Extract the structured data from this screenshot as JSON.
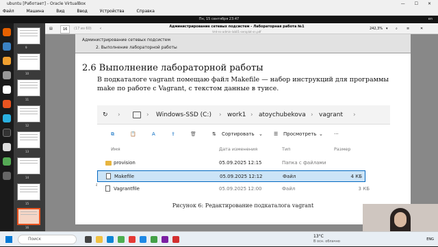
{
  "vbox": {
    "title": "ubuntu [Работает] - Oracle VirtualBox",
    "menu": [
      "Файл",
      "Машина",
      "Вид",
      "Ввод",
      "Устройства",
      "Справка"
    ]
  },
  "gnome": {
    "clock": "Пн, 15 сентября  23:47",
    "lang": "en"
  },
  "viewer": {
    "page_num": "16",
    "page_of": "(17 из 60)",
    "doc_title": "Администрирование сетевых подсистем - Лабораторная работа №1",
    "doc_path": "tmt-ns-admin-lab01-seroplat-sn.pdf",
    "zoom": "242,3%",
    "thumbs": [
      "9",
      "10",
      "11",
      "12",
      "13",
      "14",
      "15",
      "16"
    ]
  },
  "doc": {
    "header_line1": "Администрирование сетевых подсистем",
    "header_line2": "2. Выполнение лабораторной работы",
    "section_title": "2.6 Выполнение лабораторной работы",
    "paragraph": "В подкаталоге vagrant помещаю файл Makefile — набор инструкций для программы make по работе с Vagrant, с текстом данные в туисе.",
    "caption": "Рисунок 6: Редактирование подкаталога vagrant",
    "side_char": "a"
  },
  "explorer": {
    "path": [
      "Windows-SSD (C:)",
      "work1",
      "atoychubekova",
      "vagrant"
    ],
    "sort_label": "Сортировать",
    "view_label": "Просмотреть",
    "more": "···",
    "columns": {
      "name": "Имя",
      "date": "Дата изменения",
      "type": "Тип",
      "size": "Размер"
    },
    "rows": [
      {
        "name": "provision",
        "date": "05.09.2025 12:15",
        "type": "Папка с файлами",
        "size": ""
      },
      {
        "name": "Makefile",
        "date": "05.09.2025 12:12",
        "type": "Файл",
        "size": "4 КБ"
      },
      {
        "name": "Vagrantfile",
        "date": "05.09.2025 12:00",
        "type": "Файл",
        "size": "3 КБ"
      }
    ]
  },
  "taskbar": {
    "search_placeholder": "Поиск",
    "weather_temp": "13°C",
    "weather_desc": "В осн. облачно",
    "lang": "ENG"
  }
}
